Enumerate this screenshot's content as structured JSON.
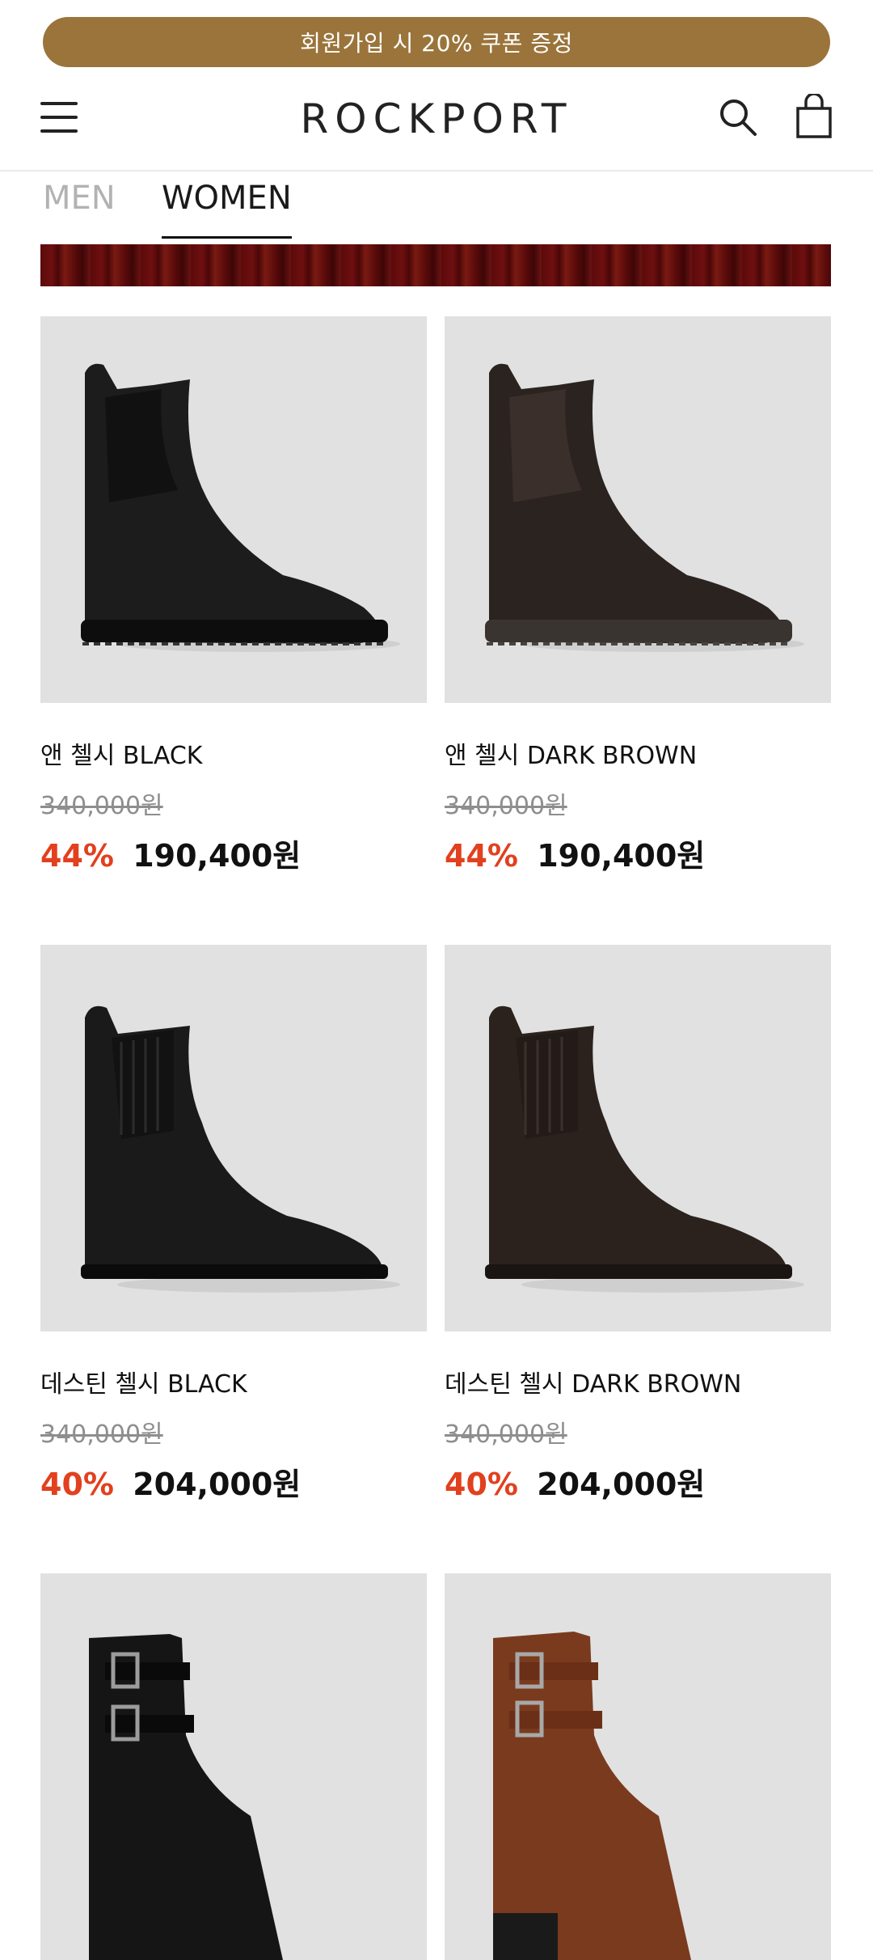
{
  "promo": {
    "text": "회원가입 시 20% 쿠폰 증정"
  },
  "header": {
    "logo": "ROCKPORT"
  },
  "tabs": [
    {
      "label": "MEN",
      "active": false
    },
    {
      "label": "WOMEN",
      "active": true
    }
  ],
  "colors": {
    "promo_bg": "#9a743a",
    "discount": "#e2401e",
    "banner": "#5c0a0a"
  },
  "products": [
    {
      "name": "앤 첼시 BLACK",
      "original_price": "340,000원",
      "discount": "44%",
      "price": "190,400원",
      "image": "chelsea-boot-black"
    },
    {
      "name": "앤 첼시 DARK BROWN",
      "original_price": "340,000원",
      "discount": "44%",
      "price": "190,400원",
      "image": "chelsea-boot-dark-brown"
    },
    {
      "name": "데스틴 첼시 BLACK",
      "original_price": "340,000원",
      "discount": "40%",
      "price": "204,000원",
      "image": "chelsea-boot-black"
    },
    {
      "name": "데스틴 첼시 DARK BROWN",
      "original_price": "340,000원",
      "discount": "40%",
      "price": "204,000원",
      "image": "chelsea-boot-dark-brown"
    },
    {
      "name": "",
      "original_price": "",
      "discount": "",
      "price": "",
      "image": "buckle-boot-black"
    },
    {
      "name": "",
      "original_price": "",
      "discount": "",
      "price": "",
      "image": "buckle-boot-brown"
    }
  ]
}
